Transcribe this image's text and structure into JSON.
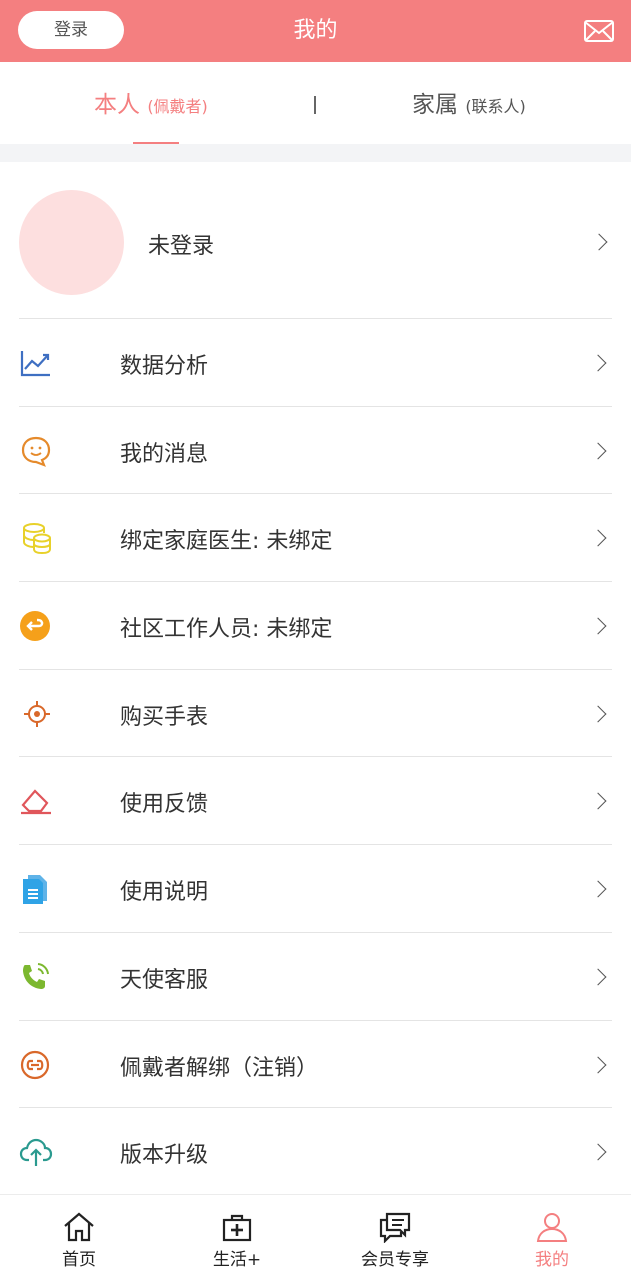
{
  "header": {
    "login_label": "登录",
    "title": "我的",
    "mail_icon": "mail-icon",
    "background_color": "#f47f80"
  },
  "tabs": {
    "self": {
      "label": "本人",
      "sub": "(佩戴者)"
    },
    "family": {
      "label": "家属",
      "sub": "(联系人)"
    },
    "active_color": "#f47f80"
  },
  "profile": {
    "name": "未登录"
  },
  "menu": [
    {
      "label": "数据分析",
      "icon": "trend-chart-icon"
    },
    {
      "label": "我的消息",
      "icon": "chat-bubble-icon"
    },
    {
      "label": "绑定家庭医生: 未绑定",
      "icon": "coins-stack-icon"
    },
    {
      "label": "社区工作人员: 未绑定",
      "icon": "return-arrow-icon"
    },
    {
      "label": "购买手表",
      "icon": "target-icon"
    },
    {
      "label": "使用反馈",
      "icon": "eraser-icon"
    },
    {
      "label": "使用说明",
      "icon": "document-icon"
    },
    {
      "label": "天使客服",
      "icon": "phone-icon"
    },
    {
      "label": "佩戴者解绑（注销）",
      "icon": "unlink-icon"
    },
    {
      "label": "版本升级",
      "icon": "cloud-upload-icon"
    }
  ],
  "bottom_nav": [
    {
      "label": "首页",
      "icon": "home-icon"
    },
    {
      "label": "生活+",
      "icon": "medical-kit-icon"
    },
    {
      "label": "会员专享",
      "icon": "chat-icon"
    },
    {
      "label": "我的",
      "icon": "user-icon",
      "active": true
    }
  ]
}
